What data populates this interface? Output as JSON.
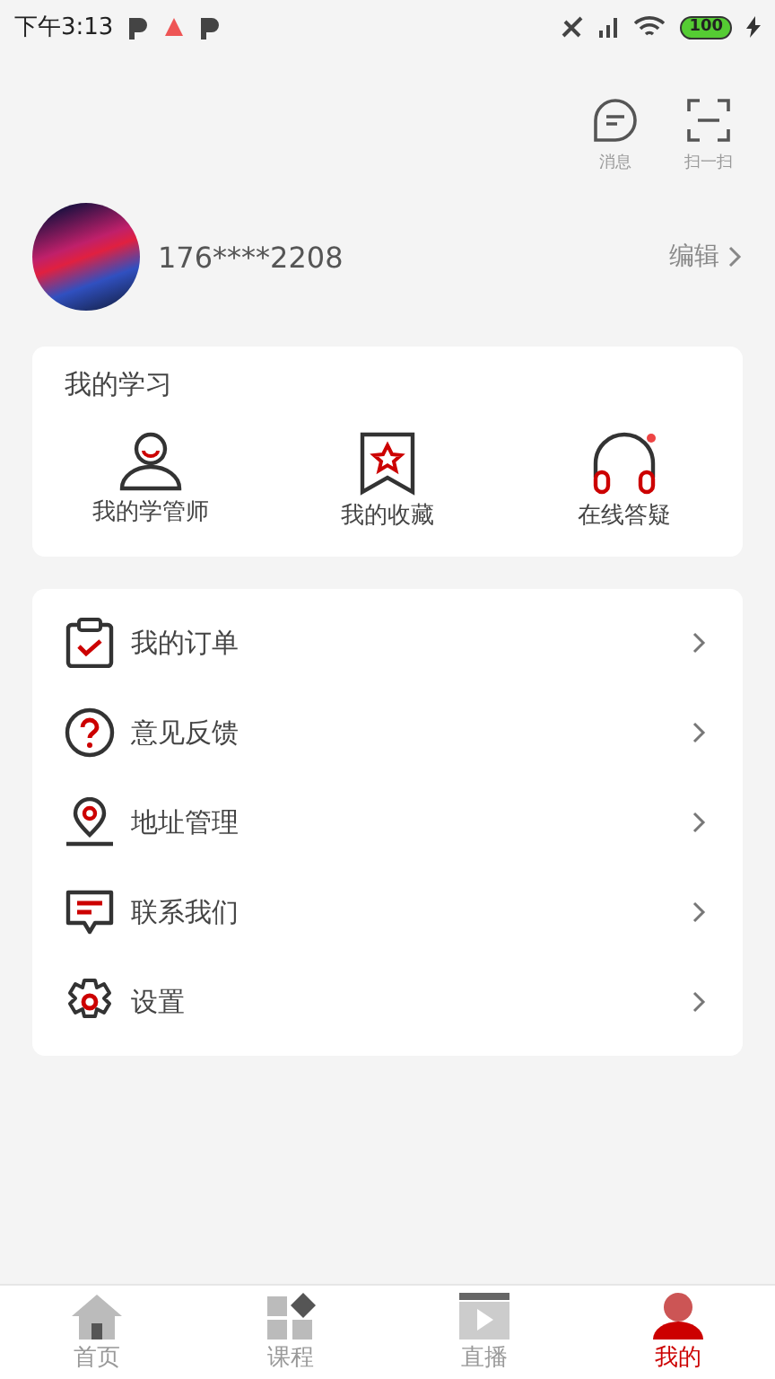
{
  "status_bar": {
    "time": "下午3:13",
    "battery": "100"
  },
  "header_actions": [
    {
      "kind": "message",
      "label": "消息"
    },
    {
      "kind": "scan",
      "label": "扫一扫"
    }
  ],
  "profile": {
    "phone": "176****2208",
    "edit": "编辑"
  },
  "study": {
    "title": "我的学习",
    "items": [
      {
        "kind": "tutor",
        "label": "我的学管师"
      },
      {
        "kind": "favorites",
        "label": "我的收藏"
      },
      {
        "kind": "qa",
        "label": "在线答疑"
      }
    ]
  },
  "menu": [
    {
      "kind": "order",
      "label": "我的订单"
    },
    {
      "kind": "feedback",
      "label": "意见反馈"
    },
    {
      "kind": "address",
      "label": "地址管理"
    },
    {
      "kind": "contact",
      "label": "联系我们"
    },
    {
      "kind": "settings",
      "label": "设置"
    }
  ],
  "tabs": [
    {
      "kind": "home",
      "label": "首页",
      "selected": false
    },
    {
      "kind": "course",
      "label": "课程",
      "selected": false
    },
    {
      "kind": "live",
      "label": "直播",
      "selected": false
    },
    {
      "kind": "mine",
      "label": "我的",
      "selected": true
    }
  ]
}
